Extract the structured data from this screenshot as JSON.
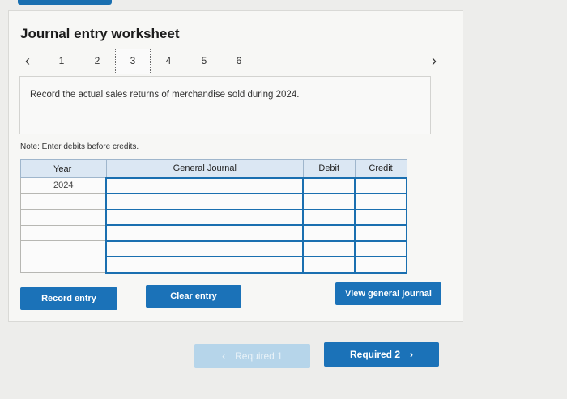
{
  "header": {
    "title": "Journal entry worksheet"
  },
  "pager": {
    "prev_icon": "chevron-left-icon",
    "next_icon": "chevron-right-icon",
    "pages": [
      "1",
      "2",
      "3",
      "4",
      "5",
      "6"
    ],
    "active_page": "3"
  },
  "question": {
    "text": "Record the actual sales returns of merchandise sold during 2024."
  },
  "note": "Note: Enter debits before credits.",
  "table": {
    "headers": {
      "year": "Year",
      "account": "General Journal",
      "debit": "Debit",
      "credit": "Credit"
    },
    "rows": [
      {
        "year": "2024",
        "account": "",
        "debit": "",
        "credit": ""
      },
      {
        "year": "",
        "account": "",
        "debit": "",
        "credit": ""
      },
      {
        "year": "",
        "account": "",
        "debit": "",
        "credit": ""
      },
      {
        "year": "",
        "account": "",
        "debit": "",
        "credit": ""
      },
      {
        "year": "",
        "account": "",
        "debit": "",
        "credit": ""
      },
      {
        "year": "",
        "account": "",
        "debit": "",
        "credit": ""
      }
    ]
  },
  "buttons": {
    "record": "Record entry",
    "clear": "Clear entry",
    "view": "View general journal"
  },
  "navigation": {
    "prev_label": "Required 1",
    "next_label": "Required 2"
  },
  "colors": {
    "accent": "#1b72b8",
    "header_bg": "#dbe7f3",
    "disabled_btn": "#b6d5ea"
  }
}
